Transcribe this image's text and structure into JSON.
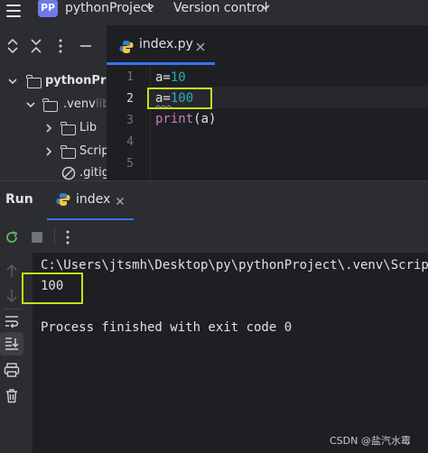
{
  "topbar": {
    "project_badge": "PP",
    "project_name": "pythonProject",
    "version_control": "Version control"
  },
  "project_tree": {
    "items": [
      {
        "label": "pythonProj"
      },
      {
        "label": ".venv",
        "suffix": "lib"
      },
      {
        "label": "Lib"
      },
      {
        "label": "Scrip"
      },
      {
        "label": ".gitig"
      }
    ]
  },
  "editor": {
    "tab_label": "index.py",
    "line_numbers": [
      "1",
      "2",
      "3",
      "4",
      "5"
    ],
    "lines": [
      {
        "prefix": "a=",
        "value": "10"
      },
      {
        "prefix": "a=",
        "value": "100"
      },
      {
        "fn": "print",
        "args": "(a)"
      }
    ]
  },
  "run": {
    "title": "Run",
    "tab_label": "index",
    "console": {
      "command": "C:\\Users\\jtsmh\\Desktop\\py\\pythonProject\\.venv\\Scrip",
      "output": "100",
      "finished": "Process finished with exit code 0"
    }
  },
  "watermark": "CSDN @盐汽水霉",
  "colors": {
    "accent": "#3574f0",
    "highlight_box": "#c4e01c",
    "number": "#2aacb8",
    "function": "#56a8f5"
  }
}
